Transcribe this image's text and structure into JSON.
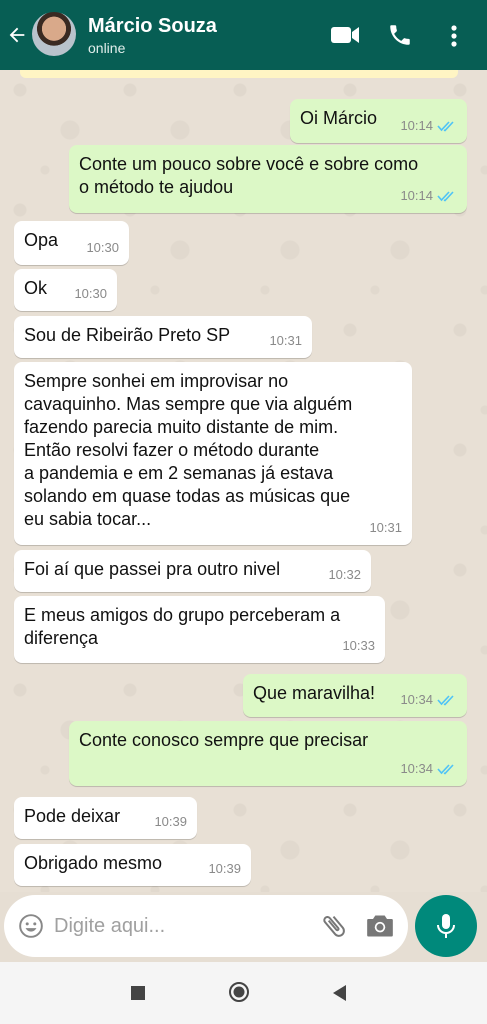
{
  "header": {
    "contact_name": "Márcio Souza",
    "status": "online",
    "icons": [
      "back-arrow-icon",
      "video-call-icon",
      "phone-icon",
      "more-options-icon"
    ],
    "background_color": "#075e54"
  },
  "messages": [
    {
      "direction": "out",
      "text": "Oi Márcio",
      "time": "10:14",
      "read": true
    },
    {
      "direction": "out",
      "text": "Conte um pouco sobre você e sobre como\no método te ajudou",
      "time": "10:14",
      "read": true
    },
    {
      "direction": "in",
      "text": "Opa",
      "time": "10:30"
    },
    {
      "direction": "in",
      "text": "Ok",
      "time": "10:30"
    },
    {
      "direction": "in",
      "text": "Sou de Ribeirão Preto SP",
      "time": "10:31"
    },
    {
      "direction": "in",
      "text": "Sempre sonhei em improvisar no\ncavaquinho. Mas sempre que via alguém\nfazendo parecia muito distante de mim.\nEntão resolvi fazer o método durante\na pandemia e em 2 semanas já estava\nsolando em quase todas as músicas que\neu sabia tocar...",
      "time": "10:31"
    },
    {
      "direction": "in",
      "text": "Foi aí que passei pra outro nivel",
      "time": "10:32"
    },
    {
      "direction": "in",
      "text": "E meus amigos do grupo perceberam a\ndiferença",
      "time": "10:33"
    },
    {
      "direction": "out",
      "text": "Que maravilha!",
      "time": "10:34",
      "read": true
    },
    {
      "direction": "out",
      "text": "Conte conosco sempre que precisar",
      "time": "10:34",
      "read": true
    },
    {
      "direction": "in",
      "text": "Pode deixar",
      "time": "10:39"
    },
    {
      "direction": "in",
      "text": "Obrigado mesmo",
      "time": "10:39"
    }
  ],
  "input_bar": {
    "placeholder": "Digite aqui...",
    "icons": [
      "emoji-icon",
      "attach-icon",
      "camera-icon",
      "mic-icon"
    ]
  },
  "colors": {
    "outgoing_bubble": "#dcf8c6",
    "incoming_bubble": "#ffffff",
    "read_ticks": "#4fc3f7",
    "mic_button": "#00897b"
  },
  "system_nav": {
    "icons": [
      "recent-apps-icon",
      "home-icon",
      "back-icon"
    ]
  }
}
